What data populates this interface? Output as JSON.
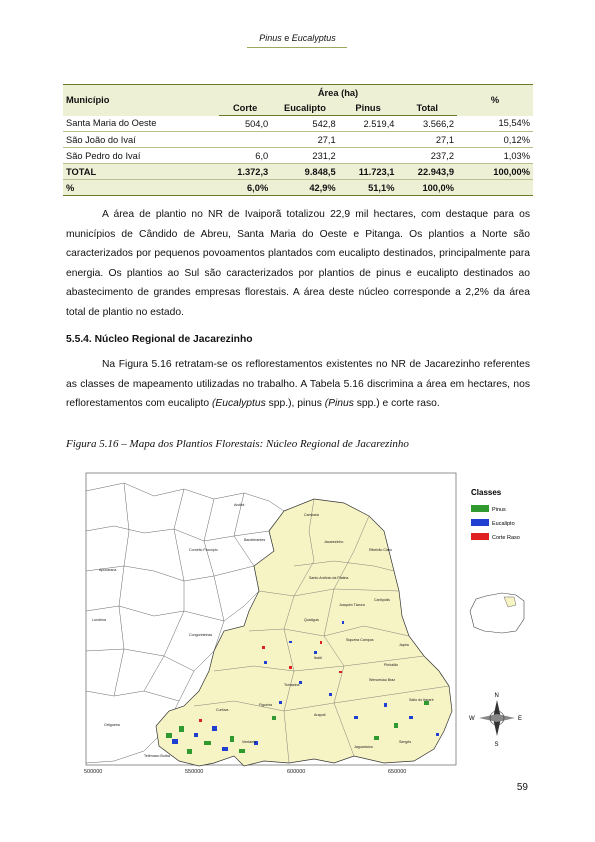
{
  "header": {
    "genus1": "Pinus",
    "conj": " e ",
    "genus2": "Eucalyptus"
  },
  "table": {
    "col_municipio": "Município",
    "col_area": "Área (ha)",
    "col_pct": "%",
    "sub_cols": [
      "Corte",
      "Eucalipto",
      "Pinus",
      "Total"
    ],
    "rows": [
      {
        "name": "Santa Maria do Oeste",
        "corte": "504,0",
        "eucalipto": "542,8",
        "pinus": "2.519,4",
        "total": "3.566,2",
        "pct": "15,54%"
      },
      {
        "name": "São João do Ivaí",
        "corte": "",
        "eucalipto": "27,1",
        "pinus": "",
        "total": "27,1",
        "pct": "0,12%"
      },
      {
        "name": "São Pedro do Ivaí",
        "corte": "6,0",
        "eucalipto": "231,2",
        "pinus": "",
        "total": "237,2",
        "pct": "1,03%"
      }
    ],
    "total_row": {
      "name": "TOTAL",
      "corte": "1.372,3",
      "eucalipto": "9.848,5",
      "pinus": "11.723,1",
      "total": "22.943,9",
      "pct": "100,00%"
    },
    "pct_row": {
      "name": "%",
      "corte": "6,0%",
      "eucalipto": "42,9%",
      "pinus": "51,1%",
      "total": "100,0%",
      "pct": ""
    }
  },
  "paragraph1": "A área de plantio no NR de Ivaiporã totalizou 22,9 mil hectares, com destaque para os municípios de Cândido de Abreu, Santa Maria do Oeste e Pitanga. Os plantios a Norte são caracterizados por pequenos povoamentos plantados com eucalipto destinados, principalmente para energia. Os plantios ao Sul são caracterizados por plantios de pinus e eucalipto destinados ao abastecimento de grandes empresas florestais. A área deste núcleo corresponde a 2,2% da área total de plantio no estado.",
  "section_title": "5.5.4.  Núcleo Regional de Jacarezinho",
  "paragraph2": {
    "a": "Na Figura 5.16 retratam-se os reflorestamentos existentes no NR de Jacarezinho referentes as classes de mapeamento utilizadas no trabalho. A Tabela 5.16 discrimina a área em hectares, nos reflorestamentos com eucalipto ",
    "b": "(Eucalyptus",
    "c": " spp.), pinus ",
    "d": "(Pinus",
    "e": " spp.) e corte raso."
  },
  "figure_caption": "Figura 5.16 – Mapa dos Plantios Florestais: Núcleo Regional de Jacarezinho",
  "map": {
    "legend_title": "Classes",
    "legend": [
      {
        "label": "Pinus",
        "color": "#2f9a2f"
      },
      {
        "label": "Eucalipto",
        "color": "#1f3fd0"
      },
      {
        "label": "Corte Raso",
        "color": "#e02020"
      }
    ],
    "x_ticks": [
      "500000",
      "550000",
      "600000",
      "650000"
    ],
    "y_ticks": [
      "7450000",
      "7400000",
      "7350000"
    ],
    "compass": {
      "n": "N",
      "s": "S",
      "e": "E",
      "w": "W"
    },
    "region_color": "#f6f3c4",
    "place_names": [
      "Jacarezinho",
      "Santo Antônio da Platina",
      "Ribeirão Claro",
      "Carlópolis",
      "Siqueira Campos",
      "Wenceslau Braz",
      "Ibaiti",
      "Japira",
      "Pinhalão",
      "Tomazina",
      "Arapoti",
      "Sengés",
      "Jaguariaíva",
      "Ventania",
      "Curiúva",
      "Telêmaco Borba",
      "Figueira",
      "Londrina",
      "Cornélio Procópio",
      "Bandeirantes",
      "Cambará",
      "Andirá",
      "Apucarana",
      "Ortigueira",
      "Congonhinhas",
      "Joaquim Távora",
      "Quatiguá",
      "Salto do Itararé"
    ]
  },
  "page_number": "59"
}
